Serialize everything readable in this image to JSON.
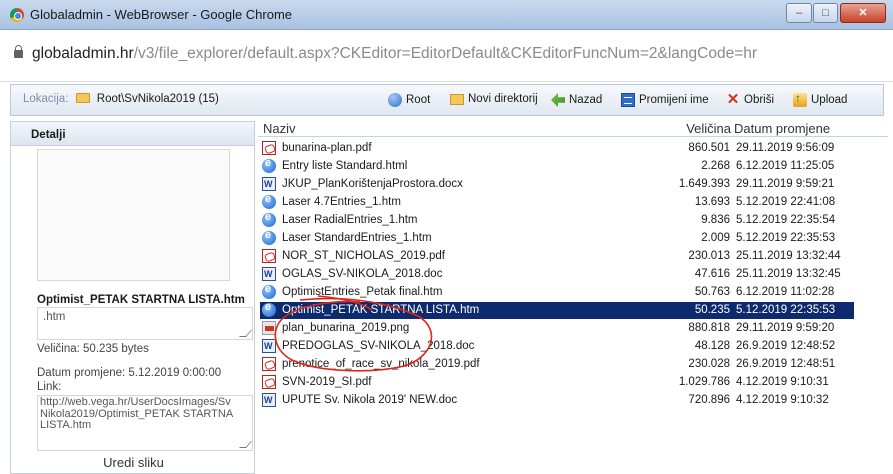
{
  "window": {
    "title": "Globaladmin - WebBrowser - Google Chrome",
    "controls": {
      "minimize": "–",
      "maximize": "□",
      "close": "✕"
    }
  },
  "address_bar": {
    "host": "globaladmin.hr",
    "path": "/v3/file_explorer/default.aspx?CKEditor=EditorDefault&CKEditorFuncNum=2&langCode=hr"
  },
  "toolbar": {
    "location_label": "Lokacija:",
    "location_path": "Root\\SvNikola2019 (15)",
    "buttons": {
      "root": "Root",
      "new_dir": "Novi direktorij",
      "back": "Nazad",
      "rename": "Promijeni ime",
      "delete": "Obriši",
      "upload": "Upload"
    }
  },
  "details": {
    "header": "Detalji",
    "file_name": "Optimist_PETAK STARTNA LISTA.htm",
    "extension": ".htm",
    "size": "Veličina: 50.235 bytes",
    "modified": "Datum promjene: 5.12.2019 0:00:00",
    "link_label": "Link:",
    "link": "http://web.vega.hr/UserDocsImages/SvNikola2019/Optimist_PETAK STARTNA LISTA.htm",
    "edit_image": "Uredi sliku"
  },
  "file_list": {
    "columns": {
      "name": "Naziv",
      "size": "Veličina",
      "date": "Datum promjene"
    },
    "rows": [
      {
        "name": "bunarina-plan.pdf",
        "size": "860.501",
        "date": "29.11.2019 9:56:09",
        "icon": "pdf-icon"
      },
      {
        "name": "Entry liste Standard.html",
        "size": "2.268",
        "date": "6.12.2019 11:25:05",
        "icon": "html-icon"
      },
      {
        "name": "JKUP_PlanKorištenjaProstora.docx",
        "size": "1.649.393",
        "date": "29.11.2019 9:59:21",
        "icon": "word-icon"
      },
      {
        "name": "Laser 4.7Entries_1.htm",
        "size": "13.693",
        "date": "5.12.2019 22:41:08",
        "icon": "html-icon"
      },
      {
        "name": "Laser RadialEntries_1.htm",
        "size": "9.836",
        "date": "5.12.2019 22:35:54",
        "icon": "html-icon"
      },
      {
        "name": "Laser StandardEntries_1.htm",
        "size": "2.009",
        "date": "5.12.2019 22:35:53",
        "icon": "html-icon"
      },
      {
        "name": "NOR_ST_NICHOLAS_2019.pdf",
        "size": "230.013",
        "date": "25.11.2019 13:32:44",
        "icon": "pdf-icon"
      },
      {
        "name": "OGLAS_SV-NIKOLA_2018.doc",
        "size": "47.616",
        "date": "25.11.2019 13:32:45",
        "icon": "word-icon"
      },
      {
        "name": "OptimistEntries_Petak final.htm",
        "size": "50.763",
        "date": "6.12.2019 11:02:28",
        "icon": "html-icon"
      },
      {
        "name": "Optimist_PETAK STARTNA LISTA.htm",
        "size": "50.235",
        "date": "5.12.2019 22:35:53",
        "icon": "html-icon",
        "selected": true
      },
      {
        "name": "plan_bunarina_2019.png",
        "size": "880.818",
        "date": "29.11.2019 9:59:20",
        "icon": "image-icon"
      },
      {
        "name": "PREDOGLAS_SV-NIKOLA_2018.doc",
        "size": "48.128",
        "date": "26.9.2019 12:48:52",
        "icon": "word-icon"
      },
      {
        "name": "prenotice_of_race_sv_nikola_2019.pdf",
        "size": "230.028",
        "date": "26.9.2019 12:48:51",
        "icon": "pdf-icon"
      },
      {
        "name": "SVN-2019_SI.pdf",
        "size": "1.029.786",
        "date": "4.12.2019 9:10:31",
        "icon": "pdf-icon"
      },
      {
        "name": "UPUTE Sv. Nikola 2019' NEW.doc",
        "size": "720.896",
        "date": "4.12.2019 9:10:32",
        "icon": "word-icon"
      }
    ]
  },
  "colors": {
    "selection": "#0e2a6f",
    "annotation": "#e0251b"
  }
}
